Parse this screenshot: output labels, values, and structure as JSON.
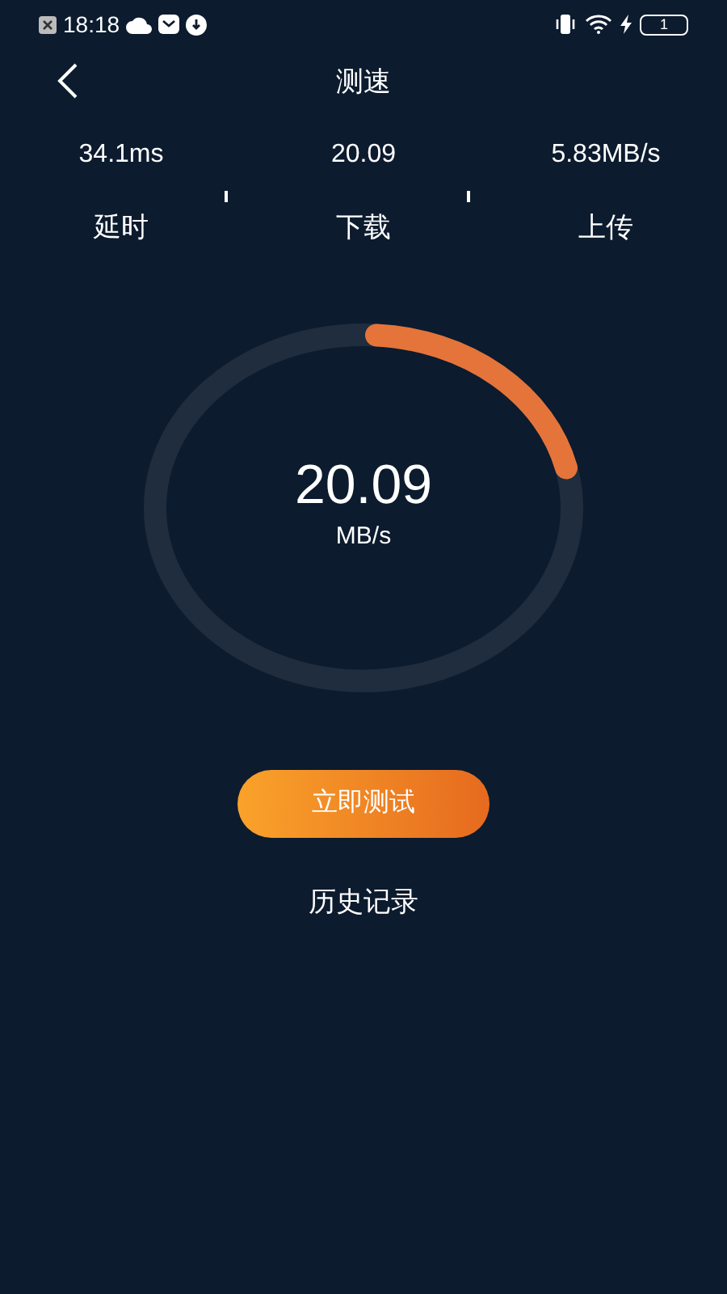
{
  "status_bar": {
    "time": "18:18",
    "battery": "1"
  },
  "header": {
    "title": "测速"
  },
  "stats": [
    {
      "value": "34.1ms",
      "label": "延时"
    },
    {
      "value": "20.09",
      "label": "下载"
    },
    {
      "value": "5.83MB/s",
      "label": "上传"
    }
  ],
  "gauge": {
    "value": "20.09",
    "unit": "MB/s"
  },
  "start_button": "立即测试",
  "history_link": "历史记录"
}
